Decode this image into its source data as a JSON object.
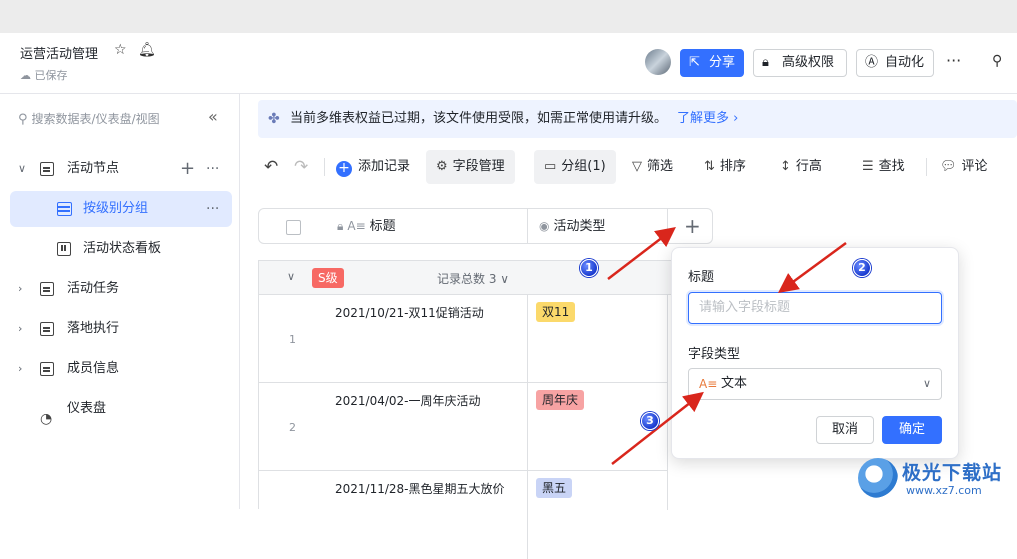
{
  "header": {
    "doc_title": "运营活动管理",
    "saved": "已保存",
    "share": "分享",
    "permission": "高级权限",
    "automation": "自动化"
  },
  "sidebar": {
    "search_placeholder": "搜索数据表/仪表盘/视图",
    "items": [
      {
        "label": "活动节点"
      },
      {
        "label": "按级别分组"
      },
      {
        "label": "活动状态看板"
      },
      {
        "label": "活动任务"
      },
      {
        "label": "落地执行"
      },
      {
        "label": "成员信息"
      },
      {
        "label": "仪表盘"
      }
    ]
  },
  "notice": {
    "text": "当前多维表权益已过期，该文件使用受限，如需正常使用请升级。",
    "link": "了解更多"
  },
  "toolbar": {
    "add_record": "添加记录",
    "field_manage": "字段管理",
    "group": "分组(1)",
    "filter": "筛选",
    "sort": "排序",
    "row_height": "行高",
    "find": "查找",
    "comment": "评论"
  },
  "table": {
    "columns": [
      "标题",
      "活动类型"
    ],
    "group": {
      "tag": "S级",
      "count": "记录总数 3"
    },
    "rows": [
      {
        "num": "1",
        "title": "2021/10/21-双11促销活动",
        "type": "双11",
        "color": "#fbd96b"
      },
      {
        "num": "2",
        "title": "2021/04/02-一周年庆活动",
        "type": "周年庆",
        "color": "#f7a3a3"
      },
      {
        "num": "",
        "title": "2021/11/28-黑色星期五大放价",
        "type": "黑五",
        "color": "#c9d4f6"
      }
    ]
  },
  "panel": {
    "title_label": "标题",
    "title_placeholder": "请输入字段标题",
    "type_label": "字段类型",
    "type_value": "文本",
    "cancel": "取消",
    "confirm": "确定"
  },
  "markers": [
    "1",
    "2",
    "3"
  ],
  "watermark": {
    "name": "极光下载站",
    "url": "www.xz7.com"
  },
  "colors": {
    "accent": "#3370ff",
    "arrow": "#d9261c"
  }
}
